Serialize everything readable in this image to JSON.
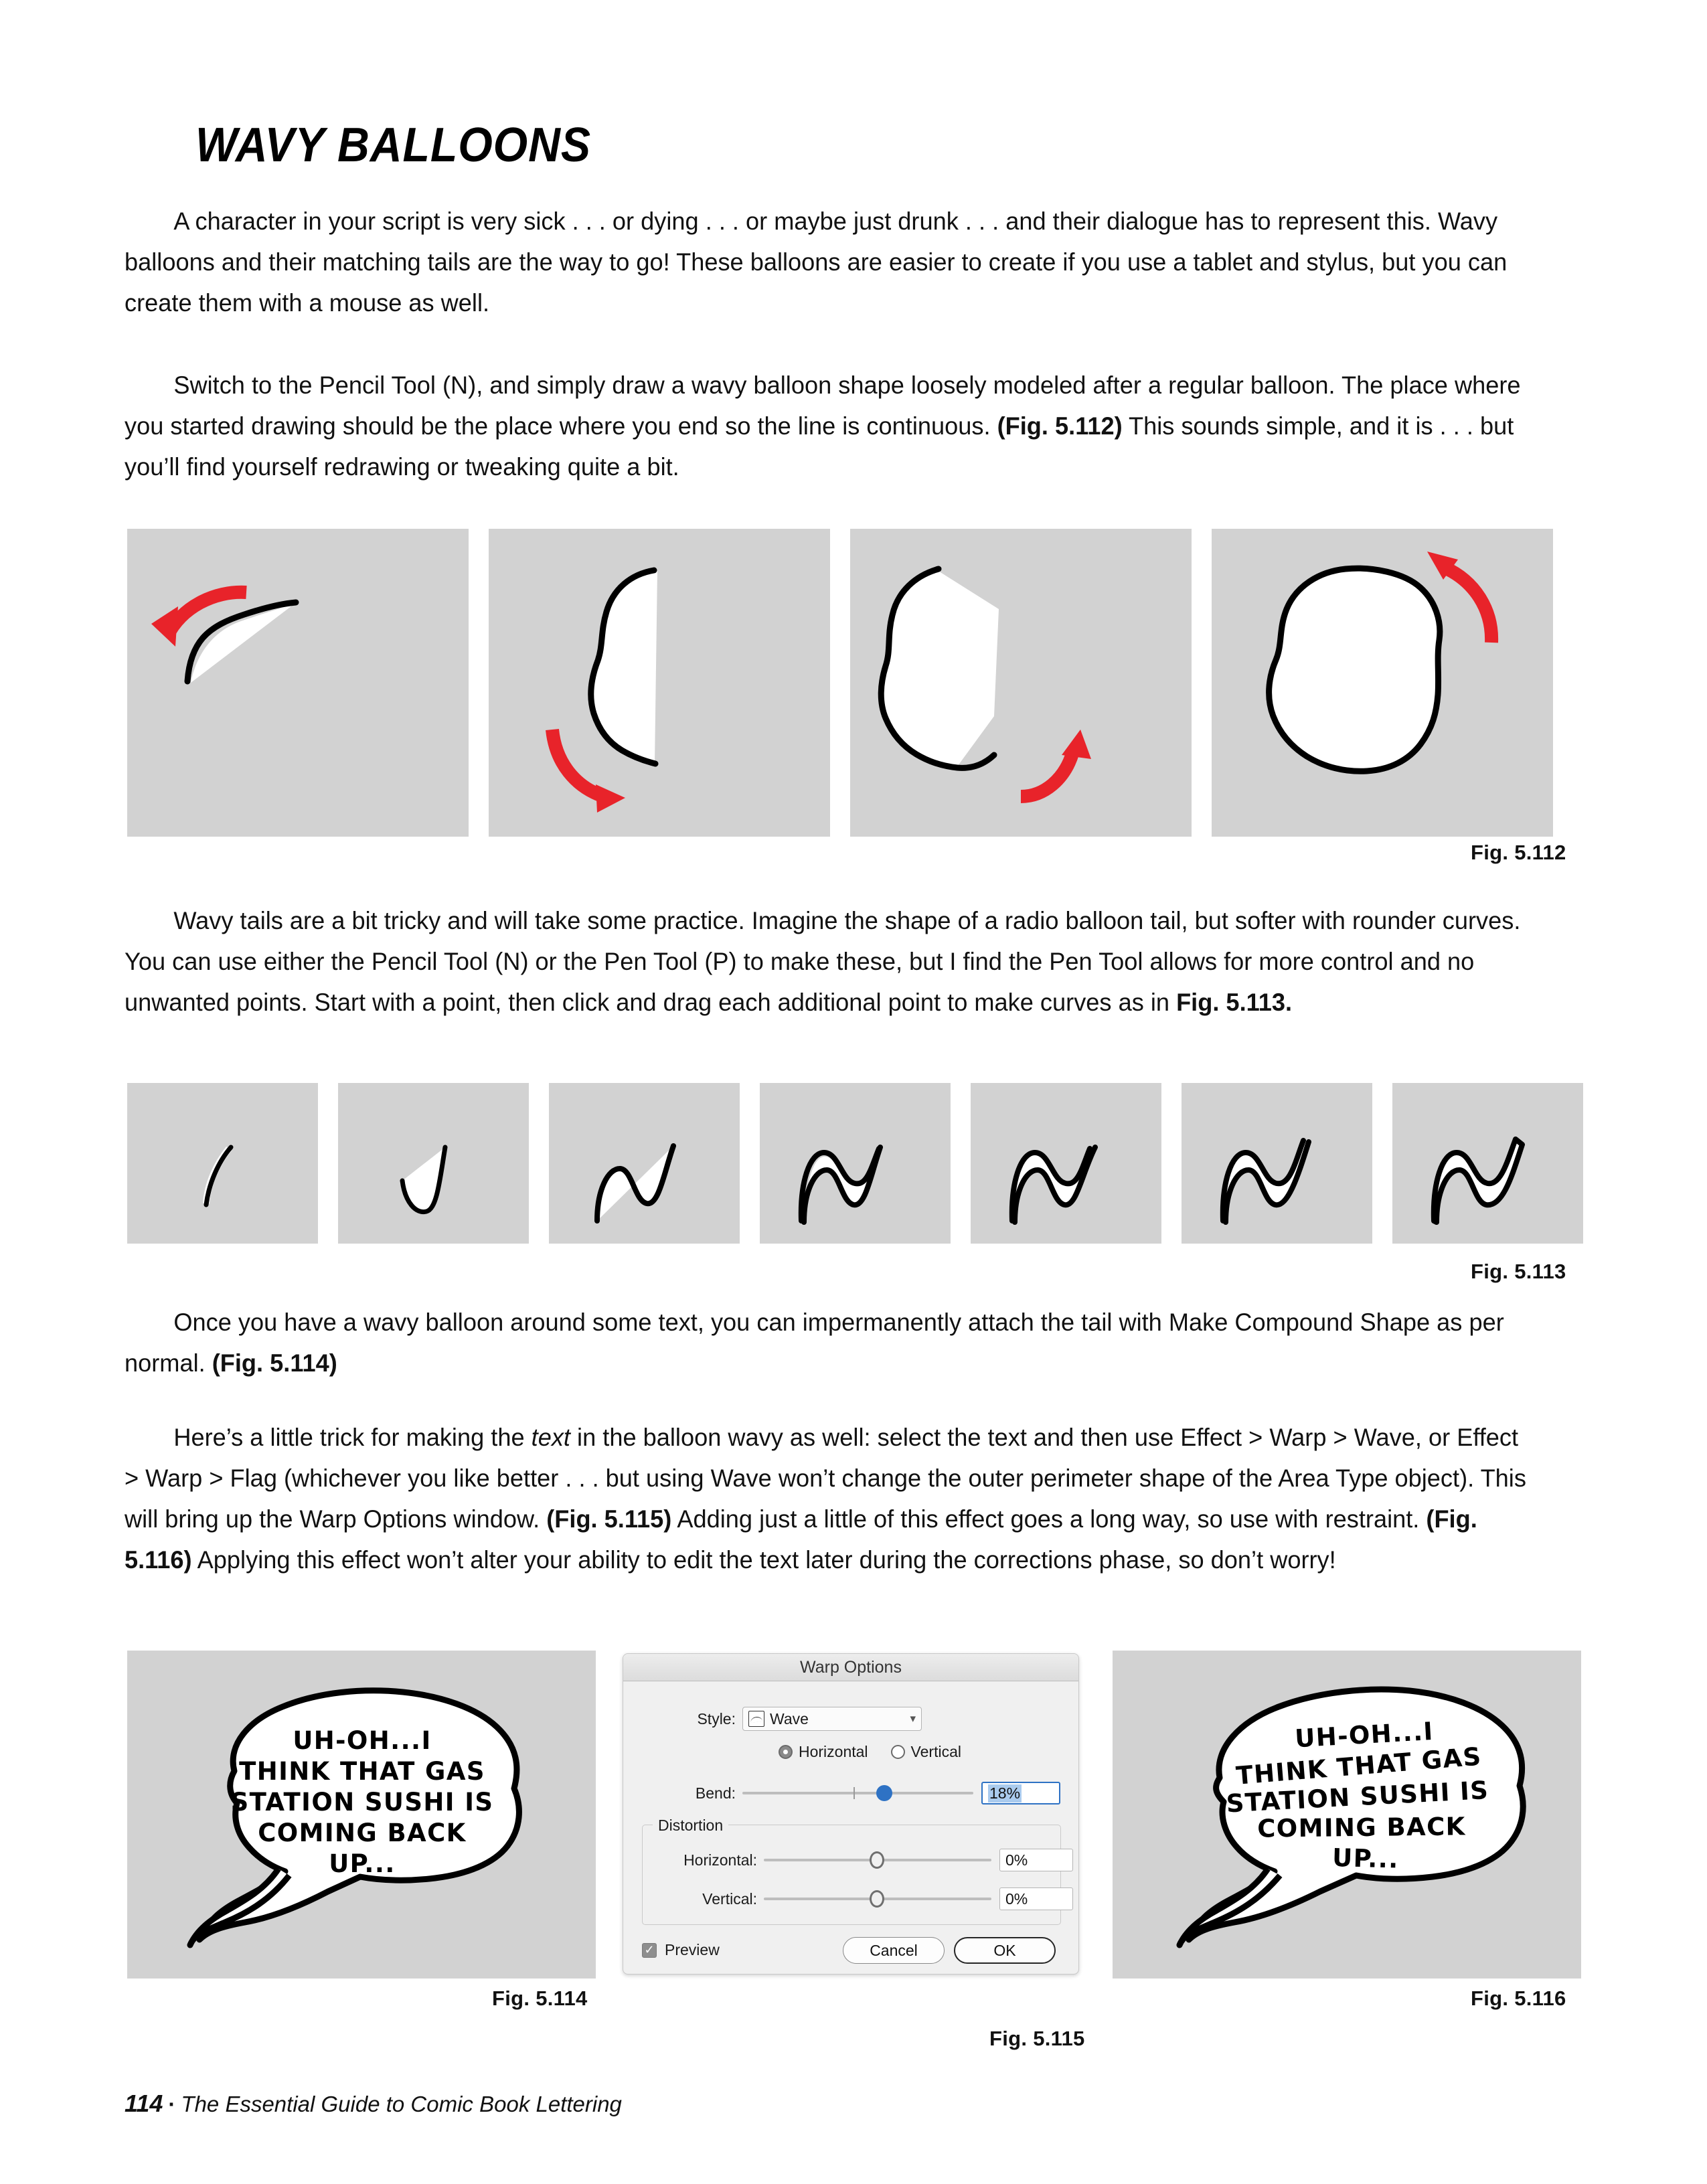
{
  "heading": "WAVY BALLOONS",
  "paragraphs": [
    {
      "id": "p1",
      "html": "A character in your script is very sick . . . or dying . . . or maybe just drunk . . . and their dialogue has to represent this. Wavy balloons and their matching tails are the way to go! These balloons are easier to create if you use a tablet and stylus, but you can create them with a mouse as well."
    },
    {
      "id": "p2",
      "html": "Switch to the Pencil Tool (N), and simply draw a wavy balloon shape loosely modeled after a regular balloon. The place where you started drawing should be the place where you end so the line is continuous. (Fig. 5.112) This sounds simple, and it is . . . but you’ll find yourself redrawing or tweaking quite a bit."
    },
    {
      "id": "p3",
      "html": "Wavy tails are a bit tricky and will take some practice. Imagine the shape of a radio balloon tail, but softer with rounder curves. You can use either the Pencil Tool (N) or the Pen Tool (P) to make these, but I find the Pen Tool allows for more control and no unwanted points. Start with a point, then click and drag each additional point to make curves as in Fig. 5.113."
    },
    {
      "id": "p4",
      "html": "Once you have a wavy balloon around some text, you can impermanently attach the tail with Make Compound Shape as per normal. (Fig. 5.114)"
    },
    {
      "id": "p5",
      "html": "Here’s a little trick for making the text in the balloon wavy as well: select the text and then use Effect > Warp > Wave, or Effect > Warp > Flag (whichever you like better . . . but using Wave won’t change the outer perimeter shape of the Area Type object). This will bring up the Warp Options window. (Fig. 5.115) Adding just a little of this effect goes a long way, so use with restraint. (Fig. 5.116) Applying this effect won’t alter your ability to edit the text later during the corrections phase, so don’t worry!"
    }
  ],
  "figures": {
    "fig_112": {
      "caption": "Fig. 5.112",
      "panels": [
        {
          "label": "balloon-step-1-arc-and-arrow"
        },
        {
          "label": "balloon-step-2-left-half"
        },
        {
          "label": "balloon-step-3-three-quarters"
        },
        {
          "label": "balloon-step-4-closed-shape"
        }
      ]
    },
    "fig_113": {
      "caption": "Fig. 5.113",
      "panels": [
        {
          "label": "tail-step-1-single-stroke"
        },
        {
          "label": "tail-step-2-hook"
        },
        {
          "label": "tail-step-3-s-curve"
        },
        {
          "label": "tail-step-4-double-wave"
        },
        {
          "label": "tail-step-5-filled-wave"
        },
        {
          "label": "tail-step-6-refined-wave"
        },
        {
          "label": "tail-step-7-closed-wave"
        }
      ]
    },
    "fig_114": {
      "caption": "Fig. 5.114"
    },
    "fig_115": {
      "caption": "Fig. 5.115"
    },
    "fig_116": {
      "caption": "Fig. 5.116"
    }
  },
  "balloon": {
    "lines": [
      "UH-OH...I",
      "THINK THAT GAS",
      "STATION SUSHI IS",
      "COMING BACK",
      "UP..."
    ]
  },
  "warp_dialog": {
    "title": "Warp Options",
    "style_label": "Style:",
    "style_value": "Wave",
    "style_icon": "wave-thumbnail-icon",
    "orientation": {
      "horizontal_label": "Horizontal",
      "vertical_label": "Vertical",
      "selected": "Horizontal"
    },
    "bend_label": "Bend:",
    "bend_value": "18%",
    "distortion_label": "Distortion",
    "distortion_horizontal_label": "Horizontal:",
    "distortion_horizontal_value": "0%",
    "distortion_vertical_label": "Vertical:",
    "distortion_vertical_value": "0%",
    "preview_label": "Preview",
    "preview_checked": true,
    "cancel_label": "Cancel",
    "ok_label": "OK"
  },
  "footer": {
    "page_number": "114",
    "separator": "·",
    "book_title": "The Essential Guide to Comic Book Lettering"
  },
  "colors": {
    "panel_gray": "#d2d2d2",
    "arrow_red": "#e8232a",
    "ink": "#000000",
    "accent_blue": "#2e72c4"
  }
}
